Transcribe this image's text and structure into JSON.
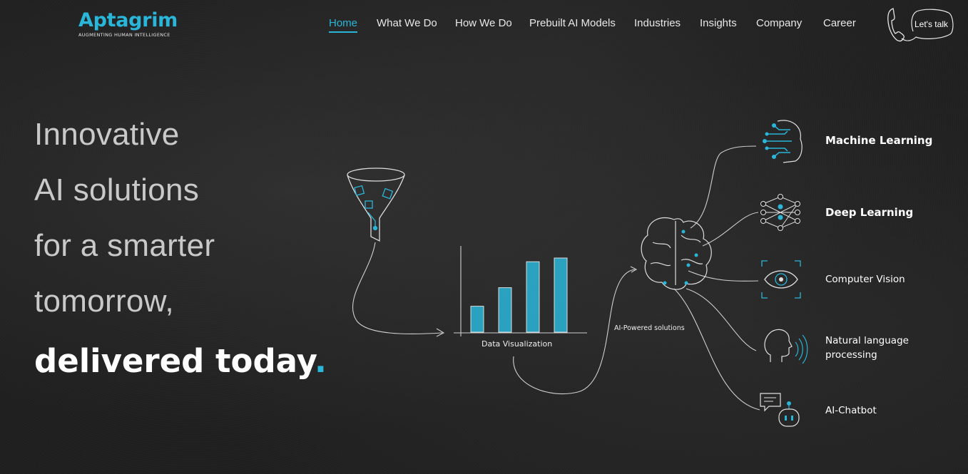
{
  "brand": {
    "name": "Aptagrim",
    "tagline": "AUGMENTING  HUMAN  INTELLIGENCE",
    "accent": "#29b6d9"
  },
  "nav": {
    "items": [
      {
        "label": "Home",
        "active": true
      },
      {
        "label": "What We Do",
        "active": false
      },
      {
        "label": "How We Do",
        "active": false
      },
      {
        "label": "Prebuilt AI Models",
        "active": false
      },
      {
        "label": "Industries",
        "active": false
      },
      {
        "label": "Insights",
        "active": false
      },
      {
        "label": "Company",
        "active": false
      },
      {
        "label": "Career",
        "active": false
      }
    ],
    "cta_label": "Let's talk",
    "cta_icon": "phone-icon"
  },
  "hero": {
    "lines": [
      "Innovative",
      "AI solutions",
      "for a smarter",
      "tomorrow,"
    ],
    "bold_line": "delivered today",
    "bold_suffix": "."
  },
  "illustration": {
    "data_label": "Data Visualization",
    "ai_label": "AI-Powered solutions",
    "bar_levels": [
      0.35,
      0.6,
      0.95,
      1.0
    ],
    "services": [
      {
        "label": "Machine Learning",
        "icon": "circuit-head-icon"
      },
      {
        "label": "Deep Learning",
        "icon": "neural-network-icon"
      },
      {
        "label": "Computer Vision",
        "icon": "eye-icon"
      },
      {
        "label": "Natural language processing",
        "line1": "Natural language",
        "line2": "processing",
        "icon": "speaking-head-icon"
      },
      {
        "label": "AI-Chatbot",
        "icon": "robot-chat-icon"
      }
    ]
  }
}
